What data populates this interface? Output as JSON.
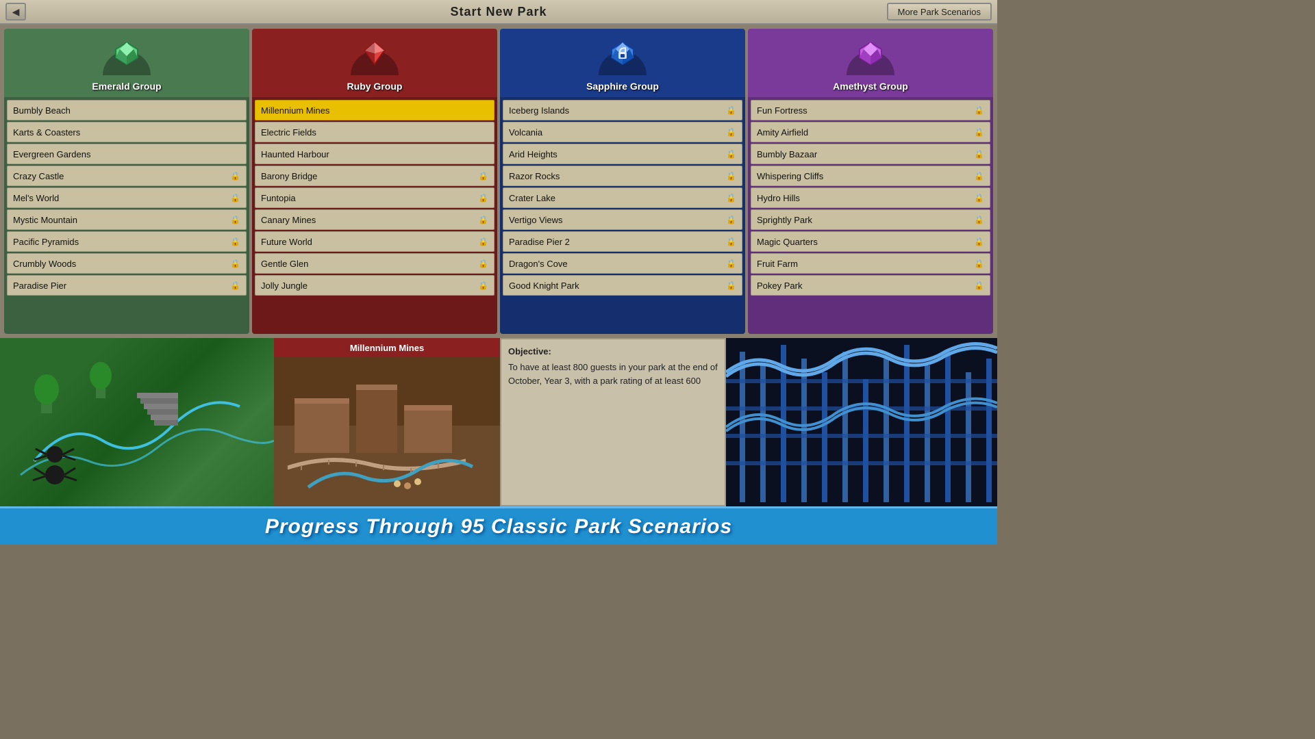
{
  "topBar": {
    "title": "Start New Park",
    "backLabel": "◀",
    "moreScenarios": "More Park Scenarios"
  },
  "groups": [
    {
      "id": "emerald",
      "name": "Emerald Group",
      "gemColor": "#60d080",
      "gemColor2": "#208040",
      "scenarios": [
        {
          "name": "Bumbly Beach",
          "locked": false
        },
        {
          "name": "Karts & Coasters",
          "locked": false
        },
        {
          "name": "Evergreen Gardens",
          "locked": false
        },
        {
          "name": "Crazy Castle",
          "locked": true
        },
        {
          "name": "Mel's World",
          "locked": true
        },
        {
          "name": "Mystic Mountain",
          "locked": true
        },
        {
          "name": "Pacific Pyramids",
          "locked": true
        },
        {
          "name": "Crumbly Woods",
          "locked": true
        },
        {
          "name": "Paradise Pier",
          "locked": true
        }
      ]
    },
    {
      "id": "ruby",
      "name": "Ruby Group",
      "gemColor": "#e04040",
      "gemColor2": "#901010",
      "scenarios": [
        {
          "name": "Millennium Mines",
          "locked": false,
          "selected": true
        },
        {
          "name": "Electric Fields",
          "locked": false
        },
        {
          "name": "Haunted Harbour",
          "locked": false
        },
        {
          "name": "Barony Bridge",
          "locked": true
        },
        {
          "name": "Funtopia",
          "locked": true
        },
        {
          "name": "Canary Mines",
          "locked": true
        },
        {
          "name": "Future World",
          "locked": true
        },
        {
          "name": "Gentle Glen",
          "locked": true
        },
        {
          "name": "Jolly Jungle",
          "locked": true
        }
      ]
    },
    {
      "id": "sapphire",
      "name": "Sapphire Group",
      "gemColor": "#4080e0",
      "gemColor2": "#1040a0",
      "scenarios": [
        {
          "name": "Iceberg Islands",
          "locked": true
        },
        {
          "name": "Volcania",
          "locked": true
        },
        {
          "name": "Arid Heights",
          "locked": true
        },
        {
          "name": "Razor Rocks",
          "locked": true
        },
        {
          "name": "Crater Lake",
          "locked": true
        },
        {
          "name": "Vertigo Views",
          "locked": true
        },
        {
          "name": "Paradise Pier 2",
          "locked": true
        },
        {
          "name": "Dragon's Cove",
          "locked": true
        },
        {
          "name": "Good Knight Park",
          "locked": true
        }
      ]
    },
    {
      "id": "amethyst",
      "name": "Amethyst Group",
      "gemColor": "#c060e0",
      "gemColor2": "#8020a0",
      "scenarios": [
        {
          "name": "Fun Fortress",
          "locked": true
        },
        {
          "name": "Amity Airfield",
          "locked": true
        },
        {
          "name": "Bumbly Bazaar",
          "locked": true
        },
        {
          "name": "Whispering Cliffs",
          "locked": true
        },
        {
          "name": "Hydro Hills",
          "locked": true
        },
        {
          "name": "Sprightly Park",
          "locked": true
        },
        {
          "name": "Magic Quarters",
          "locked": true
        },
        {
          "name": "Fruit Farm",
          "locked": true
        },
        {
          "name": "Pokey Park",
          "locked": true
        }
      ]
    }
  ],
  "preview": {
    "selectedScenario": "Millennium Mines",
    "objectiveLabel": "Objective:",
    "objectiveText": "To have at least 800 guests in your park at the end of October, Year 3, with a park rating of at least 600"
  },
  "banner": {
    "text": "Progress Through 95 Classic Park Scenarios"
  }
}
